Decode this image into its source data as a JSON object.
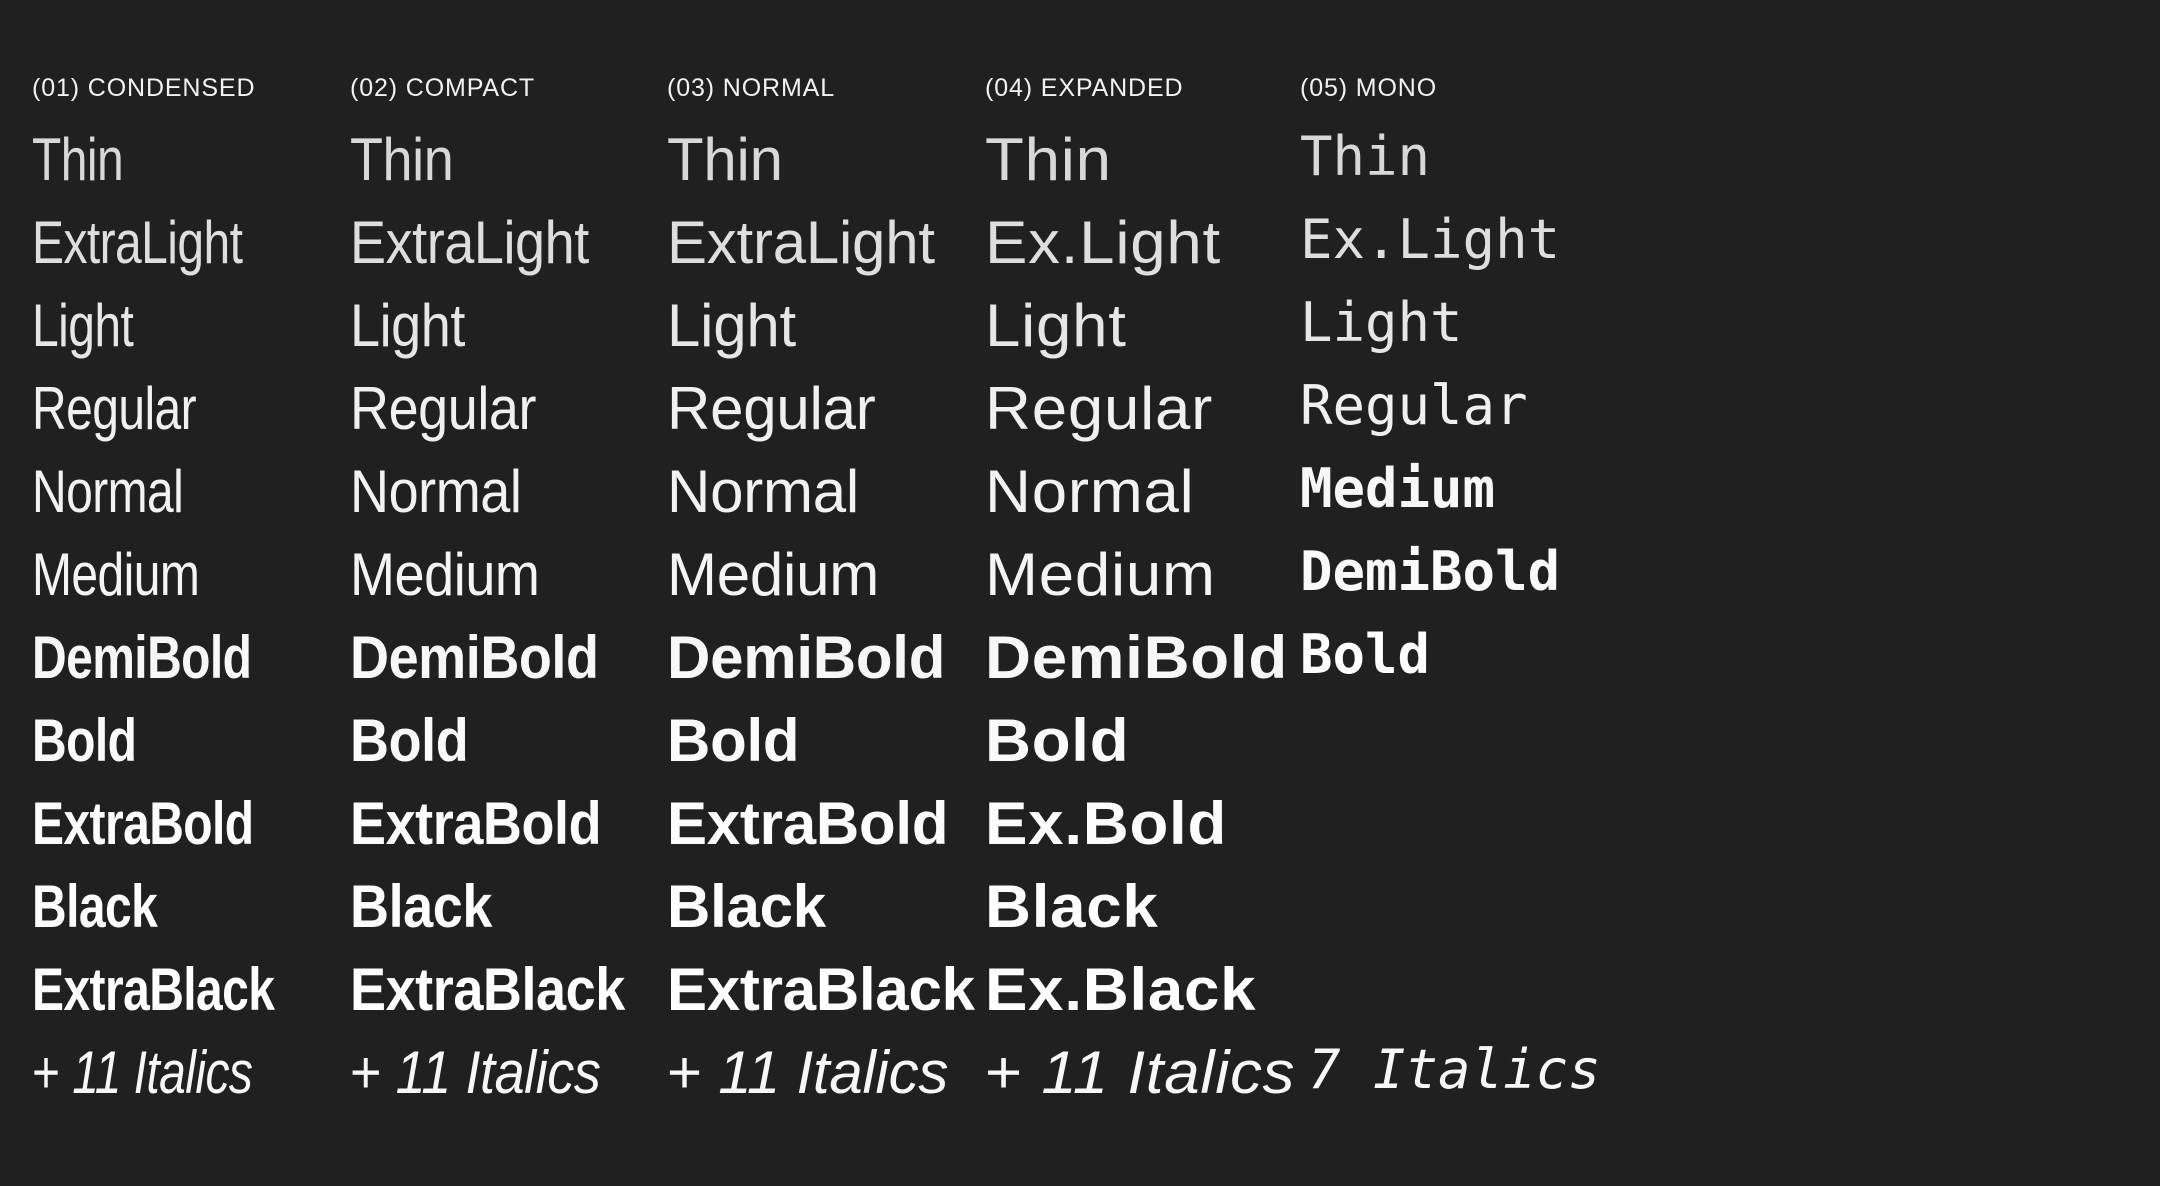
{
  "page": {
    "background_color": "#202020",
    "text_color": "#f7f7f7",
    "title": "Type Family Weight & Width Specimen"
  },
  "columns": [
    {
      "header": "(01) CONDENSED",
      "key": "condensed",
      "weights": [
        "Thin",
        "ExtraLight",
        "Light",
        "Regular",
        "Normal",
        "Medium",
        "DemiBold",
        "Bold",
        "ExtraBold",
        "Black",
        "ExtraBlack"
      ],
      "footer_prefix": "+ ",
      "footer_italic": "11 Italics"
    },
    {
      "header": "(02) COMPACT",
      "key": "compact",
      "weights": [
        "Thin",
        "ExtraLight",
        "Light",
        "Regular",
        "Normal",
        "Medium",
        "DemiBold",
        "Bold",
        "ExtraBold",
        "Black",
        "ExtraBlack"
      ],
      "footer_prefix": "+ ",
      "footer_italic": "11 Italics"
    },
    {
      "header": "(03) NORMAL",
      "key": "normal",
      "weights": [
        "Thin",
        "ExtraLight",
        "Light",
        "Regular",
        "Normal",
        "Medium",
        "DemiBold",
        "Bold",
        "ExtraBold",
        "Black",
        "ExtraBlack"
      ],
      "footer_prefix": "+ ",
      "footer_italic": "11 Italics"
    },
    {
      "header": "(04) EXPANDED",
      "key": "expanded",
      "weights": [
        "Thin",
        "Ex.Light",
        "Light",
        "Regular",
        "Normal",
        "Medium",
        "DemiBold",
        "Bold",
        "Ex.Bold",
        "Black",
        "Ex.Black"
      ],
      "footer_prefix": "+ ",
      "footer_italic": "11 Italics"
    },
    {
      "header": "(05) MONO",
      "key": "mono",
      "weights": [
        "Thin",
        "Ex.Light",
        "Light",
        "Regular",
        "Medium",
        "DemiBold",
        "Bold"
      ],
      "footer_prefix": "",
      "footer_italic": "7 Italics"
    }
  ]
}
